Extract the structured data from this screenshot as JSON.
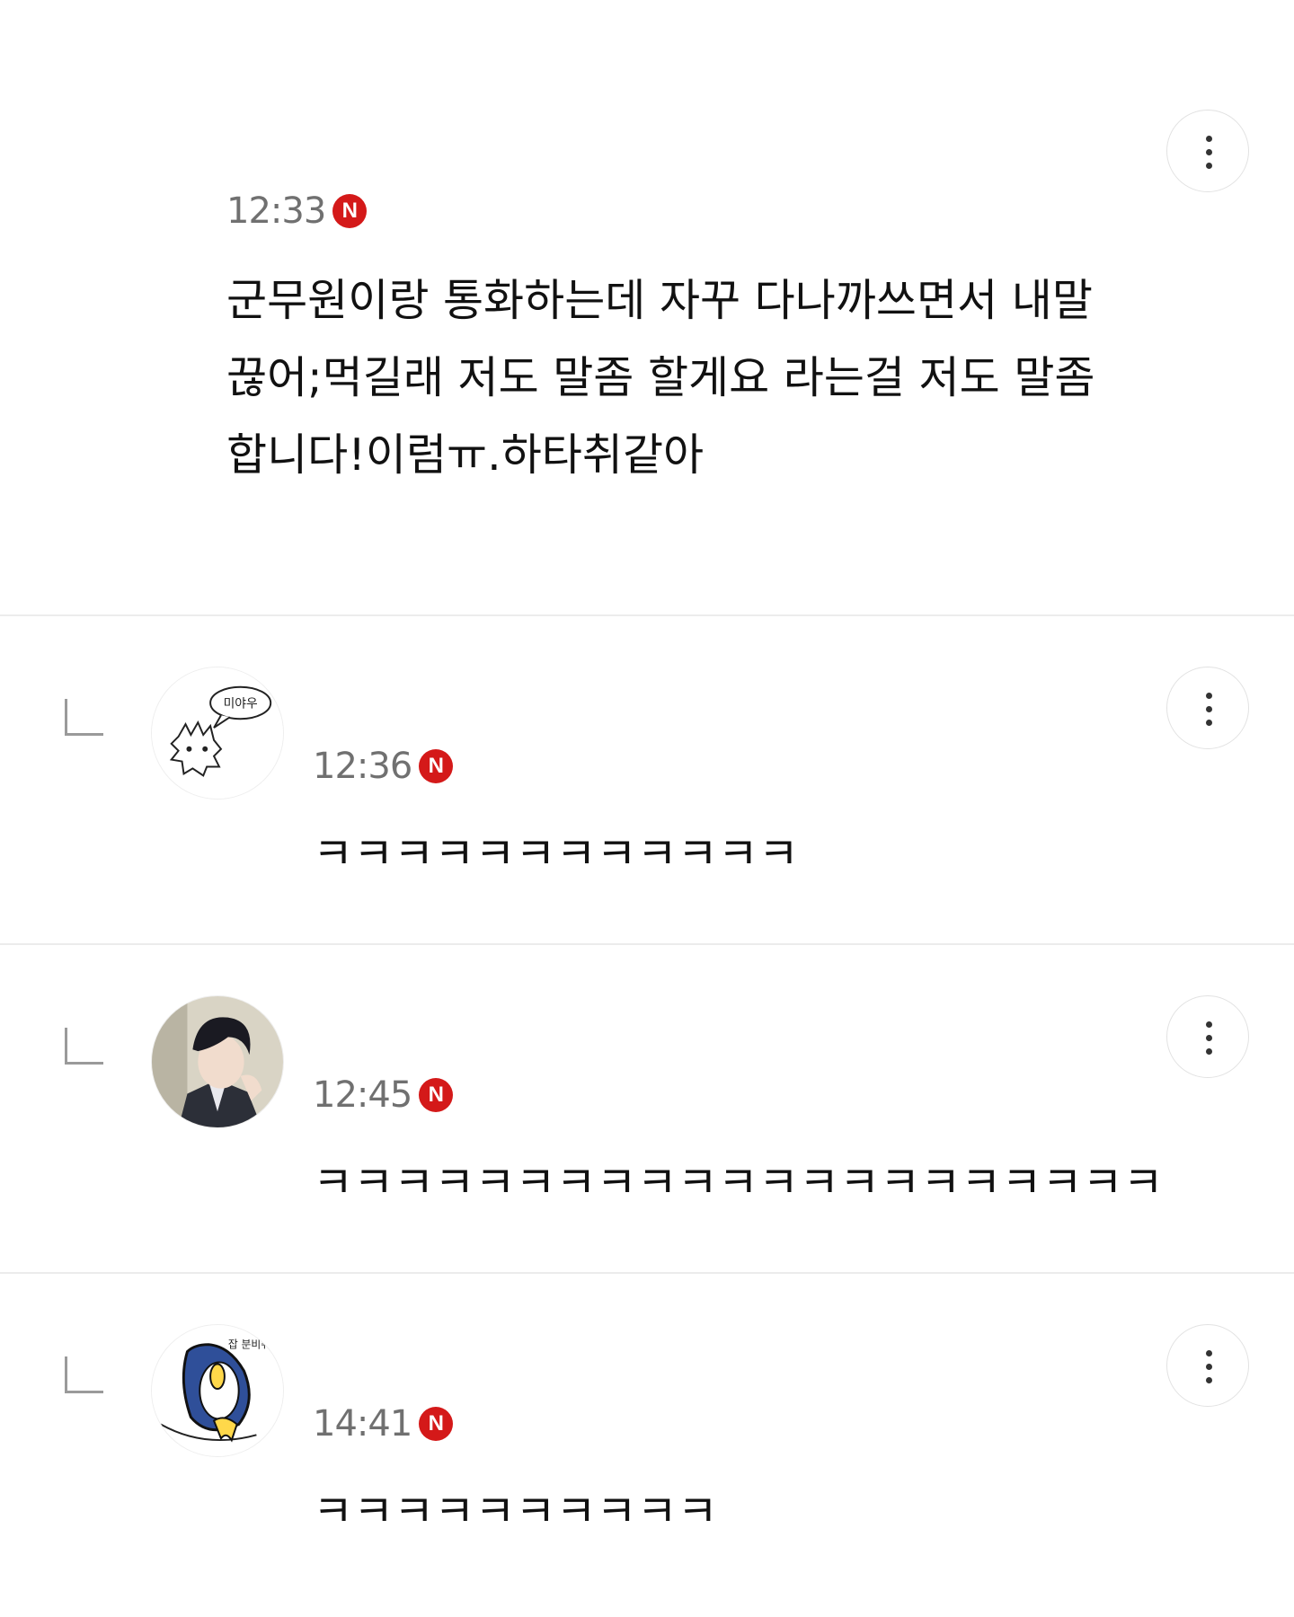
{
  "comments": [
    {
      "time": "12:33",
      "badge": "N",
      "lines": [
        "군무원이랑 통화하는데 자꾸 다나까쓰면서 내말",
        "끊어;먹길래 저도 말좀 할게요 라는걸 저도 말좀",
        "합니다!이럼ㅠ.하타취같아"
      ],
      "is_reply": false
    },
    {
      "time": "12:36",
      "badge": "N",
      "text": "ㅋㅋㅋㅋㅋㅋㅋㅋㅋㅋㅋㅋ",
      "is_reply": true,
      "avatar_icon": "cat-doodle-avatar-icon",
      "avatar_bubble_text": "미야우"
    },
    {
      "time": "12:45",
      "badge": "N",
      "text": "ㅋㅋㅋㅋㅋㅋㅋㅋㅋㅋㅋㅋㅋㅋㅋㅋㅋㅋㅋㅋㅋ",
      "is_reply": true,
      "avatar_icon": "anime-man-avatar-icon"
    },
    {
      "time": "14:41",
      "badge": "N",
      "text": "ㅋㅋㅋㅋㅋㅋㅋㅋㅋㅋ",
      "is_reply": true,
      "avatar_icon": "penguin-sticker-avatar-icon",
      "avatar_bubble_text": "잡 분비취"
    }
  ],
  "icons": {
    "more": "more-vertical-icon",
    "reply": "reply-arrow-icon",
    "new": "new-badge-icon"
  },
  "colors": {
    "badge": "#d41919",
    "time": "#707070",
    "divider": "#ececec"
  }
}
